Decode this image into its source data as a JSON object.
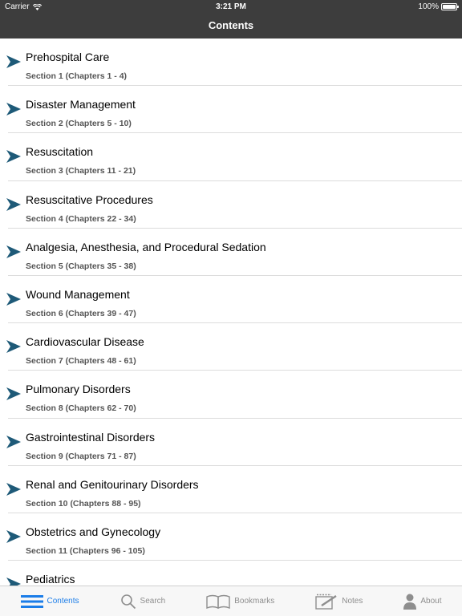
{
  "status_bar": {
    "carrier": "Carrier",
    "time": "3:21 PM",
    "battery": "100%"
  },
  "nav": {
    "title": "Contents"
  },
  "colors": {
    "bar_background": "#3d3d3d",
    "chevron": "#1e5a78",
    "tab_active": "#1b7de8",
    "tab_inactive": "#8e8e8e"
  },
  "sections": [
    {
      "title": "Prehospital Care",
      "subtitle": "Section 1 (Chapters 1 - 4)"
    },
    {
      "title": "Disaster Management",
      "subtitle": "Section 2 (Chapters 5 - 10)"
    },
    {
      "title": "Resuscitation",
      "subtitle": "Section 3 (Chapters 11 - 21)"
    },
    {
      "title": "Resuscitative Procedures",
      "subtitle": "Section 4 (Chapters 22 - 34)"
    },
    {
      "title": "Analgesia, Anesthesia, and Procedural Sedation",
      "subtitle": "Section 5 (Chapters 35 - 38)"
    },
    {
      "title": "Wound Management",
      "subtitle": "Section 6 (Chapters 39 - 47)"
    },
    {
      "title": "Cardiovascular Disease",
      "subtitle": "Section 7 (Chapters 48 - 61)"
    },
    {
      "title": "Pulmonary Disorders",
      "subtitle": "Section 8 (Chapters 62 - 70)"
    },
    {
      "title": "Gastrointestinal Disorders",
      "subtitle": "Section 9 (Chapters 71 - 87)"
    },
    {
      "title": "Renal and Genitourinary Disorders",
      "subtitle": "Section 10 (Chapters 88 - 95)"
    },
    {
      "title": "Obstetrics and Gynecology",
      "subtitle": "Section 11 (Chapters 96 - 105)"
    },
    {
      "title": "Pediatrics",
      "subtitle": ""
    }
  ],
  "tabs": [
    {
      "label": "Contents",
      "icon": "list-icon",
      "active": true
    },
    {
      "label": "Search",
      "icon": "search-icon",
      "active": false
    },
    {
      "label": "Bookmarks",
      "icon": "book-icon",
      "active": false
    },
    {
      "label": "Notes",
      "icon": "notes-icon",
      "active": false
    },
    {
      "label": "About",
      "icon": "person-icon",
      "active": false
    }
  ]
}
